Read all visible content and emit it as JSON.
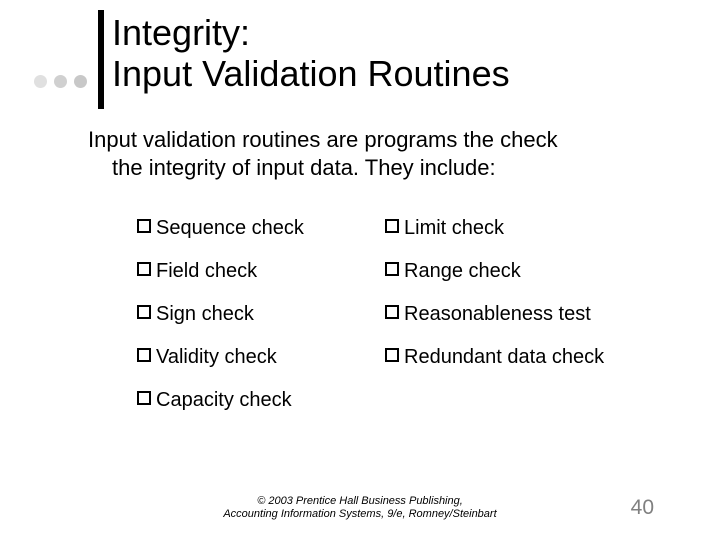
{
  "title": {
    "line1": "Integrity:",
    "line2": "Input Validation Routines"
  },
  "body": {
    "line1": "Input validation routines are programs the check",
    "line2": "the integrity of input data.  They include:"
  },
  "checks": {
    "r0": {
      "left": "Sequence check",
      "right": "Limit check"
    },
    "r1": {
      "left": "Field check",
      "right": "Range check"
    },
    "r2": {
      "left": "Sign check",
      "right": "Reasonableness test"
    },
    "r3": {
      "left": "Validity check",
      "right": "Redundant data check"
    },
    "r4": {
      "left": "Capacity check"
    }
  },
  "footer": {
    "line1": "© 2003 Prentice Hall Business Publishing,",
    "line2": "Accounting Information Systems, 9/e, Romney/Steinbart"
  },
  "page": "40"
}
